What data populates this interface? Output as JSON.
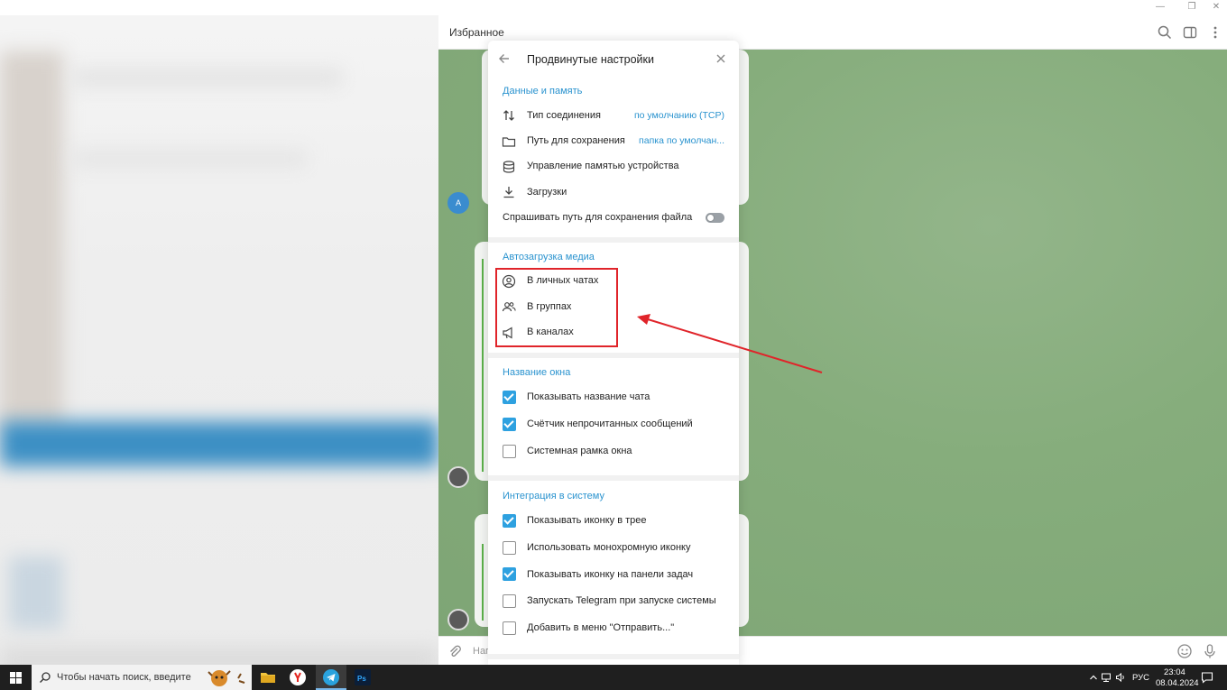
{
  "chat": {
    "title": "Избранное",
    "avatar_letter": "A",
    "input_placeholder": "Нап"
  },
  "dialog": {
    "title": "Продвинутые настройки",
    "sections": {
      "data": {
        "title": "Данные и память",
        "connection_label": "Тип соединения",
        "connection_value": "по умолчанию (TCP)",
        "save_path_label": "Путь для сохранения",
        "save_path_value": "папка по умолчан...",
        "storage_label": "Управление памятью устройства",
        "downloads_label": "Загрузки",
        "ask_path_label": "Спрашивать путь для сохранения файла",
        "ask_path_on": false
      },
      "autodownload": {
        "title": "Автозагрузка медиа",
        "private_label": "В личных чатах",
        "groups_label": "В группах",
        "channels_label": "В каналах"
      },
      "window_title": {
        "title": "Название окна",
        "items": [
          {
            "label": "Показывать название чата",
            "checked": true
          },
          {
            "label": "Счётчик непрочитанных сообщений",
            "checked": true
          },
          {
            "label": "Системная рамка окна",
            "checked": false
          }
        ]
      },
      "integration": {
        "title": "Интеграция в систему",
        "items": [
          {
            "label": "Показывать иконку в трее",
            "checked": true
          },
          {
            "label": "Использовать монохромную иконку",
            "checked": false
          },
          {
            "label": "Показывать иконку на панели задач",
            "checked": true
          },
          {
            "label": "Запускать Telegram при запуске системы",
            "checked": false
          },
          {
            "label": "Добавить в меню \"Отправить...\"",
            "checked": false
          }
        ]
      }
    }
  },
  "taskbar": {
    "search_placeholder": "Чтобы начать поиск, введите",
    "language": "РУС",
    "time": "23:04",
    "date": "08.04.2024"
  },
  "colors": {
    "accent": "#2a93cf",
    "checkbox_on": "#2ea1e0",
    "highlight": "#e0242a",
    "chat_bg": "#86ad7c"
  }
}
